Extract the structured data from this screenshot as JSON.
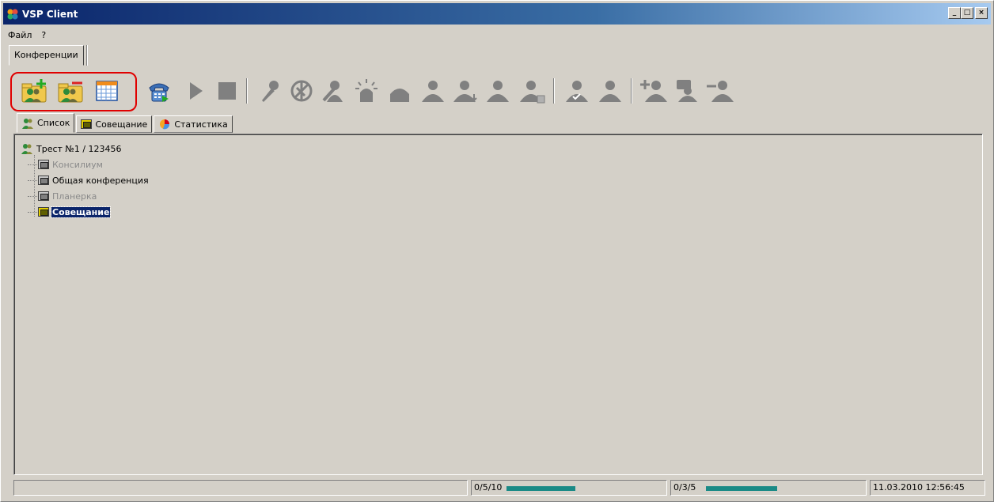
{
  "window": {
    "title": "VSP Client",
    "controls": {
      "minimize": "_",
      "maximize": "□",
      "close": "×"
    }
  },
  "menu": {
    "file": "Файл",
    "help": "?"
  },
  "top_tabs": [
    {
      "label": "Конференции"
    }
  ],
  "toolbar": {
    "buttons": [
      "add-conference-icon",
      "remove-conference-icon",
      "schedule-icon",
      "dial-phone-icon",
      "play-icon",
      "stop-icon",
      "microphone-off-icon",
      "speaker-off-icon",
      "video-off-icon",
      "alarm-icon",
      "user-icon",
      "user-down-icon",
      "user-down-alt-icon",
      "user-left-icon",
      "user-remove-icon",
      "user-check-icon",
      "user-alt-icon",
      "add-user-icon",
      "user-chat-icon",
      "remove-user-icon"
    ]
  },
  "tabs": [
    {
      "label": "Список",
      "icon": "users-icon",
      "active": true
    },
    {
      "label": "Совещание",
      "icon": "conference-icon",
      "active": false
    },
    {
      "label": "Статистика",
      "icon": "pie-chart-icon",
      "active": false
    }
  ],
  "tree": {
    "root": {
      "label": "Трест №1 / 123456",
      "icon": "users-icon"
    },
    "children": [
      {
        "label": "Консилиум",
        "state": "inactive"
      },
      {
        "label": "Общая конференция",
        "state": "normal"
      },
      {
        "label": "Планерка",
        "state": "inactive"
      },
      {
        "label": "Совещание",
        "state": "selected"
      }
    ]
  },
  "status": {
    "left_text": "",
    "counter1": "0/5/10",
    "counter1_fill": 0.58,
    "counter2": "0/3/5",
    "counter2_fill": 0.6,
    "datetime": "11.03.2010 12:56:45"
  },
  "colors": {
    "highlight": "#e00000",
    "selection": "#0a246a",
    "progress": "#1a8a86",
    "titlebar": "#0a246a"
  }
}
